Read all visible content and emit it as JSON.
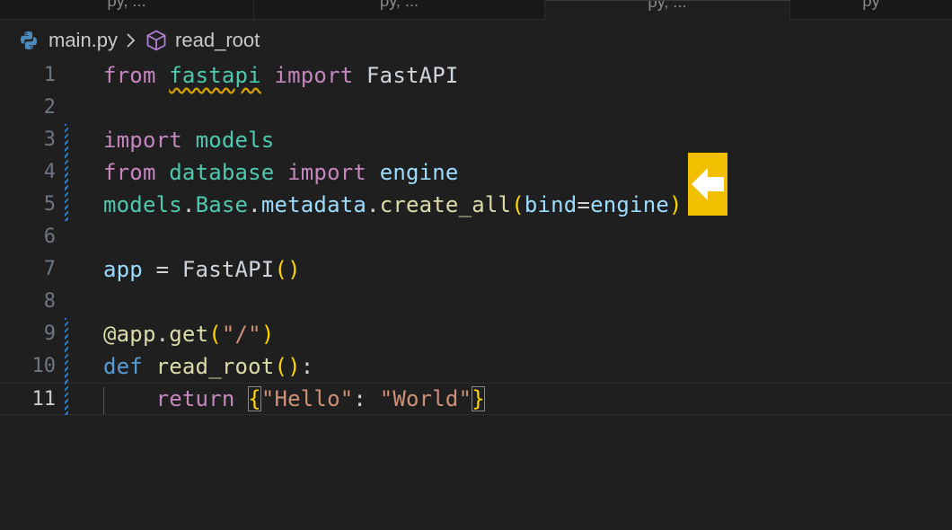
{
  "tabs": [
    {
      "label": "ρy, ..."
    },
    {
      "label": "ρy, ..."
    },
    {
      "label": "ρy, ..."
    },
    {
      "label": "ρy"
    }
  ],
  "breadcrumb": {
    "file_icon": "python-icon",
    "file": "main.py",
    "separator_icon": "chevron-right-icon",
    "symbol_icon": "cube-icon",
    "symbol": "read_root"
  },
  "editor": {
    "current_line": 11,
    "lines": [
      {
        "number": "1",
        "tokens": [
          "from",
          " ",
          "fastapi",
          " ",
          "import",
          " FastAPI"
        ]
      },
      {
        "number": "2",
        "tokens": []
      },
      {
        "number": "3",
        "tokens": [
          "import",
          " ",
          "models"
        ]
      },
      {
        "number": "4",
        "tokens": [
          "from",
          " ",
          "database",
          " ",
          "import",
          " ",
          "engine"
        ]
      },
      {
        "number": "5",
        "tokens": [
          "models",
          ".",
          "Base",
          ".",
          "metadata",
          ".",
          "create_all",
          "(",
          "bind",
          "=",
          "engine",
          ")"
        ]
      },
      {
        "number": "6",
        "tokens": []
      },
      {
        "number": "7",
        "tokens": [
          "app",
          " = ",
          "FastAPI",
          "(",
          ")"
        ]
      },
      {
        "number": "8",
        "tokens": []
      },
      {
        "number": "9",
        "tokens": [
          "@app",
          ".",
          "get",
          "(",
          "\"/\"",
          ")"
        ]
      },
      {
        "number": "10",
        "tokens": [
          "def",
          " ",
          "read_root",
          "(",
          ")",
          ":"
        ]
      },
      {
        "number": "11",
        "tokens": [
          "    ",
          "return",
          " ",
          "{",
          "\"Hello\"",
          ": ",
          "\"World\"",
          "}"
        ]
      }
    ]
  },
  "annotation": {
    "icon": "left-arrow-icon",
    "color": "#f2be00"
  },
  "colors": {
    "background": "#1f1f1f",
    "keyword": "#c586c0",
    "def_keyword": "#569cd6",
    "module": "#4ec9b0",
    "variable": "#9cdcfe",
    "function": "#dcdcaa",
    "string": "#ce9178",
    "bracket": "#ffd700",
    "diff_marker": "#2f7fd1"
  }
}
